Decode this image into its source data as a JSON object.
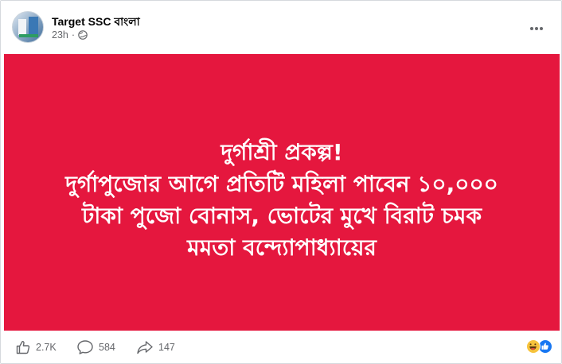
{
  "post": {
    "page_name": "Target SSC বাংলা",
    "time": "23h",
    "separator": "·",
    "audience_icon": "globe-icon",
    "more_icon": "more-horizontal-icon"
  },
  "image": {
    "background": "#e5173e",
    "text_color": "#ffffff",
    "lines": [
      "দুর্গাশ্রী প্রকল্প!",
      "দুর্গাপুজোর আগে প্রতিটি মহিলা পাবেন ১০,০০০",
      "টাকা পুজো বোনাস, ভোটের মুখে বিরাট চমক",
      "মমতা বন্দ্যোপাধ্যায়ের"
    ]
  },
  "footer": {
    "likes": "2.7K",
    "comments": "584",
    "shares": "147",
    "reaction_icons": [
      "haha-emoji-icon",
      "like-reaction-icon"
    ]
  }
}
